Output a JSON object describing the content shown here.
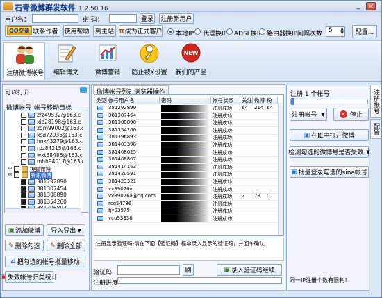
{
  "window": {
    "title": "石青微博群发软件",
    "version": "1.2.50.16",
    "min": "_",
    "close": "×"
  },
  "login": {
    "user_label": "用户名：",
    "pass_label": "密  码：",
    "login_btn": "登录",
    "register_btn": "注册新用户"
  },
  "toolbar": {
    "qq_label": "QQ交谈",
    "contact": "联系作者",
    "help": "使用帮助",
    "site": "到主站",
    "vip": "成为正式客户",
    "ip_options": [
      "本地IP",
      "代理换IP",
      "ADSL换IP",
      "路由器换IP"
    ],
    "ip_selected": 0,
    "interval_label": "间隔次数",
    "interval_value": "5",
    "config": "配置..."
  },
  "tools": [
    {
      "label": "注册微博帐号",
      "icon": "users-icon",
      "active": true
    },
    {
      "label": "编辑博文",
      "icon": "edit-note-icon",
      "active": false
    },
    {
      "label": "微博营销",
      "icon": "chart-icon",
      "active": false
    },
    {
      "label": "防止被K设置",
      "icon": "wrench-icon",
      "active": false
    },
    {
      "label": "我们的产品",
      "icon": "new-badge-icon",
      "active": false
    }
  ],
  "left": {
    "can_open": "可以打开",
    "col1": "微博帐号",
    "col2": "帐号移动目标",
    "tree": [
      {
        "text": "zrz49532@163.c",
        "indent": 2,
        "checked": false
      },
      {
        "text": "xie28198@163.c",
        "indent": 2,
        "checked": false
      },
      {
        "text": "zgm99002@163.c",
        "indent": 2,
        "checked": false
      },
      {
        "text": "xsd72036@163.c",
        "indent": 2,
        "checked": false
      },
      {
        "text": "hnx43279@163.c",
        "indent": 2,
        "checked": false
      },
      {
        "text": "rpz84215@163.c",
        "indent": 2,
        "checked": false
      },
      {
        "text": "wxt58486@163.c",
        "indent": 2,
        "checked": false
      },
      {
        "text": "mhh94017@163.c",
        "indent": 2,
        "checked": false
      },
      {
        "text": "搜狐微博",
        "indent": 1,
        "checked": false,
        "folder": true
      },
      {
        "text": "腾讯微博",
        "indent": 1,
        "checked": false,
        "folder": true,
        "selected": true
      },
      {
        "text": "381292890",
        "indent": 2,
        "checked": true
      },
      {
        "text": "381307454",
        "indent": 2,
        "checked": true
      },
      {
        "text": "381308890",
        "indent": 2,
        "checked": true
      },
      {
        "text": "381354260",
        "indent": 2,
        "checked": true
      },
      {
        "text": "381396893",
        "indent": 2,
        "checked": true
      }
    ],
    "buttons": {
      "add": "添加微博",
      "import_export": "导入导出",
      "del_checked": "删除勾选",
      "del_all": "删除全部",
      "batch_move": "把勾选的帐号批量移动",
      "fail_stat": "失效帐号归类统计"
    }
  },
  "center": {
    "tabs": [
      "微博帐号列表",
      "浏览器操作"
    ],
    "columns": [
      "类型",
      "帐号用户名",
      "密码",
      "帐号状态",
      "关注",
      "微博",
      "粉"
    ],
    "rows": [
      {
        "user": "381292890",
        "status": "注册成功",
        "follow": "64",
        "weibo": "214",
        "fans": "64"
      },
      {
        "user": "381307454",
        "status": "注册成功",
        "follow": "",
        "weibo": "",
        "fans": ""
      },
      {
        "user": "381308890",
        "status": "注册成功",
        "follow": "",
        "weibo": "",
        "fans": ""
      },
      {
        "user": "381354260",
        "status": "注册成功",
        "follow": "",
        "weibo": "",
        "fans": ""
      },
      {
        "user": "381396893",
        "status": "注册成功",
        "follow": "",
        "weibo": "",
        "fans": ""
      },
      {
        "user": "381403398",
        "status": "注册成功",
        "follow": "",
        "weibo": "",
        "fans": ""
      },
      {
        "user": "381408625",
        "status": "注册成功",
        "follow": "",
        "weibo": "",
        "fans": ""
      },
      {
        "user": "381408807",
        "status": "注册成功",
        "follow": "",
        "weibo": "",
        "fans": ""
      },
      {
        "user": "381414163",
        "status": "注册成功",
        "follow": "",
        "weibo": "",
        "fans": ""
      },
      {
        "user": "381420591",
        "status": "注册成功",
        "follow": "",
        "weibo": "",
        "fans": ""
      },
      {
        "user": "381423321",
        "status": "注册成功",
        "follow": "",
        "weibo": "",
        "fans": ""
      },
      {
        "user": "vv89076v",
        "status": "注册成功",
        "follow": "",
        "weibo": "",
        "fans": ""
      },
      {
        "user": "vv89076a@qq.com",
        "status": "注册成功",
        "follow": "2",
        "weibo": "79",
        "fans": "0"
      },
      {
        "user": "rcg54786",
        "status": "注册成功",
        "follow": "",
        "weibo": "",
        "fans": ""
      },
      {
        "user": "fjy93979",
        "status": "注册成功",
        "follow": "",
        "weibo": "",
        "fans": ""
      },
      {
        "user": "vcu93338",
        "status": "注册成功",
        "follow": "",
        "weibo": "",
        "fans": ""
      }
    ],
    "log_text": "注册显示验证码-请在下面【验证码】框中录入显示的验证码，并回车确认",
    "captcha_label": "验证码",
    "refresh_btn": "刷",
    "submit_captcha": "录入验证码继续",
    "progress_label": "注册进度"
  },
  "right": {
    "register_count": "注册 1 个帐号",
    "register_account": "注册帐号",
    "stop": "停止",
    "open_in_browser": "在IE中打开微博",
    "check_valid": "检测勾选的微博号是否失效",
    "batch_login": "批量登录勾选的sina帐号",
    "ip_limit": "同一IP注册个数有限制！"
  },
  "side_tabs": [
    "注册帐号",
    "配置"
  ]
}
